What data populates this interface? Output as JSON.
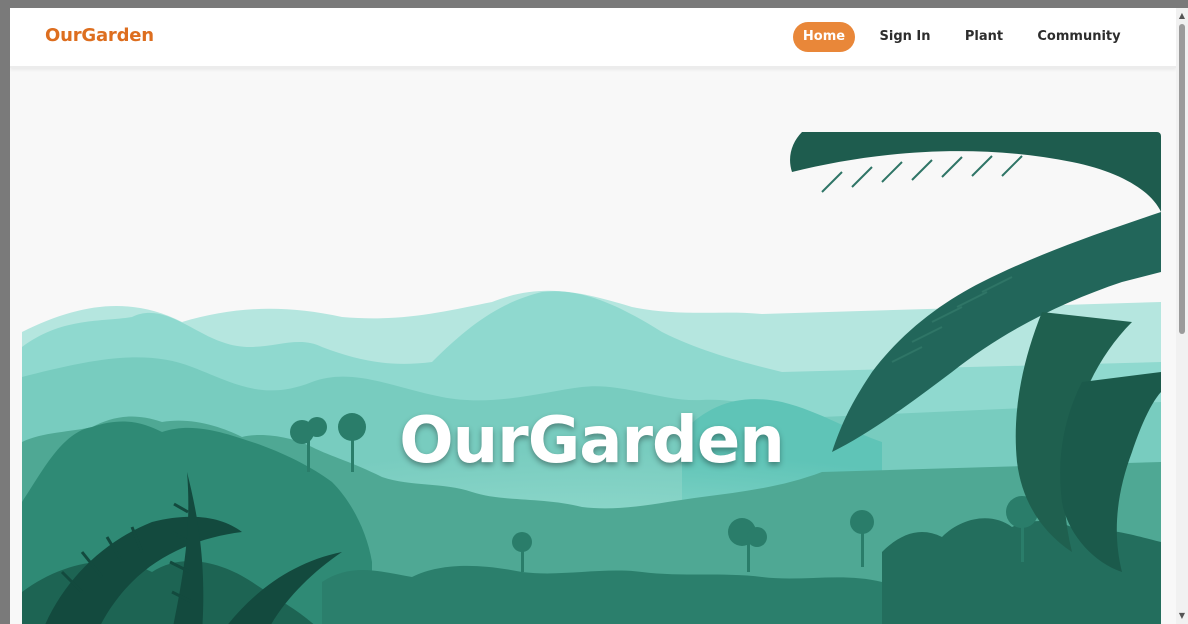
{
  "brand": {
    "name": "OurGarden",
    "color": "#dd6e1f"
  },
  "nav": {
    "items": [
      {
        "label": "Home",
        "active": true
      },
      {
        "label": "Sign In",
        "active": false
      },
      {
        "label": "Plant",
        "active": false
      },
      {
        "label": "Community",
        "active": false
      }
    ],
    "active_color": "#e98739"
  },
  "hero": {
    "title": "OurGarden",
    "image": "jungle-landscape-illustration",
    "palette": [
      "#b5e6df",
      "#8fd9cf",
      "#5fb9a5",
      "#3c9a85",
      "#23705e",
      "#1c5c4c"
    ]
  },
  "scrollbar": {
    "up_icon": "triangle-up-icon",
    "down_icon": "triangle-down-icon"
  }
}
